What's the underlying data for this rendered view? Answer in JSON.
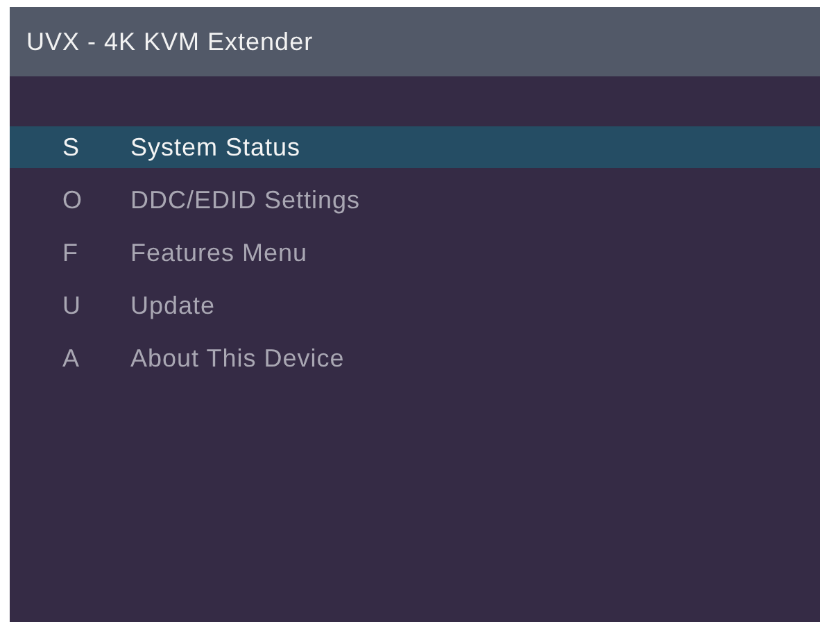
{
  "window": {
    "title": "UVX - 4K KVM Extender"
  },
  "menu": [
    {
      "key": "S",
      "label": "System Status",
      "selected": true
    },
    {
      "key": "O",
      "label": "DDC/EDID Settings",
      "selected": false
    },
    {
      "key": "F",
      "label": "Features Menu",
      "selected": false
    },
    {
      "key": "U",
      "label": "Update",
      "selected": false
    },
    {
      "key": "A",
      "label": "About This Device",
      "selected": false
    }
  ]
}
